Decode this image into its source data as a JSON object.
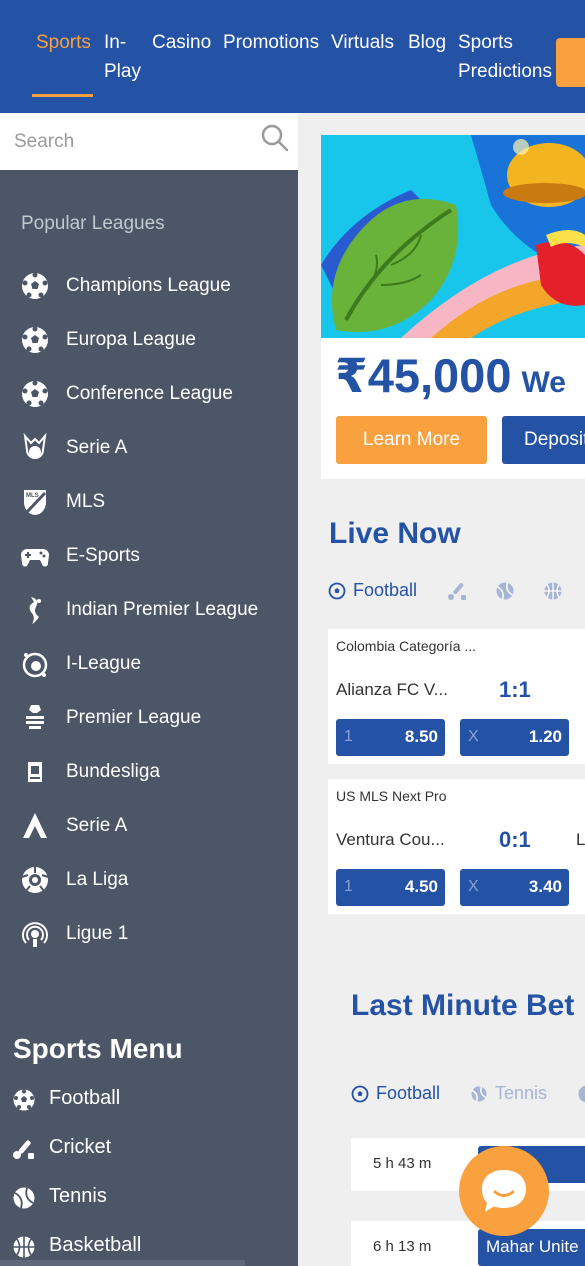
{
  "header": {
    "nav": [
      {
        "label": "Sports",
        "active": true
      },
      {
        "label": "In-"
      },
      {
        "label": "Play"
      },
      {
        "label": "Casino"
      },
      {
        "label": "Promotions"
      },
      {
        "label": "Virtuals"
      },
      {
        "label": "Blog"
      },
      {
        "label": "Sports"
      },
      {
        "label": "Predictions"
      }
    ]
  },
  "search": {
    "placeholder": "Search"
  },
  "sidebar": {
    "popular_title": "Popular Leagues",
    "leagues": [
      {
        "label": "Champions League",
        "icon": "soccer-ball-icon"
      },
      {
        "label": "Europa League",
        "icon": "soccer-ball-icon"
      },
      {
        "label": "Conference League",
        "icon": "soccer-ball-icon"
      },
      {
        "label": "Serie A",
        "icon": "serie-a-logo-icon"
      },
      {
        "label": "MLS",
        "icon": "mls-logo-icon"
      },
      {
        "label": "E-Sports",
        "icon": "gamepad-icon"
      },
      {
        "label": "Indian Premier League",
        "icon": "ipl-logo-icon"
      },
      {
        "label": "I-League",
        "icon": "i-league-logo-icon"
      },
      {
        "label": "Premier League",
        "icon": "premier-league-logo-icon"
      },
      {
        "label": "Bundesliga",
        "icon": "bundesliga-logo-icon"
      },
      {
        "label": "Serie A",
        "icon": "serie-a-alt-logo-icon"
      },
      {
        "label": "La Liga",
        "icon": "la-liga-logo-icon"
      },
      {
        "label": "Ligue 1",
        "icon": "ligue-1-logo-icon"
      }
    ],
    "sports_menu_title": "Sports Menu",
    "sports_menu": [
      {
        "label": "Football",
        "icon": "football-icon"
      },
      {
        "label": "Cricket",
        "icon": "cricket-icon"
      },
      {
        "label": "Tennis",
        "icon": "tennis-icon"
      },
      {
        "label": "Basketball",
        "icon": "basketball-icon"
      }
    ]
  },
  "promo": {
    "amount": "₹45,000",
    "amount_suffix": "We",
    "learn_more": "Learn More",
    "deposit": "Deposit"
  },
  "live": {
    "title": "Live Now",
    "active_tab": "Football",
    "matches": [
      {
        "league": "Colombia Categoría ...",
        "team": "Alianza FC V...",
        "team2": "",
        "score": "1:1",
        "odds": [
          {
            "k": "1",
            "v": "8.50"
          },
          {
            "k": "X",
            "v": "1.20"
          }
        ]
      },
      {
        "league": "US MLS Next Pro",
        "team": "Ventura Cou...",
        "team2": "L",
        "score": "0:1",
        "odds": [
          {
            "k": "1",
            "v": "4.50"
          },
          {
            "k": "X",
            "v": "3.40"
          }
        ]
      }
    ]
  },
  "last_minute": {
    "title": "Last Minute Bet",
    "tabs": [
      "Football",
      "Tennis"
    ],
    "rows": [
      {
        "time": "5 h 43 m",
        "team": ""
      },
      {
        "time": "6 h 13 m",
        "team": "Mahar Unite"
      }
    ]
  },
  "colors": {
    "brand": "#2452a4",
    "accent": "#f9a03f",
    "sidebar": "#4c5666"
  }
}
